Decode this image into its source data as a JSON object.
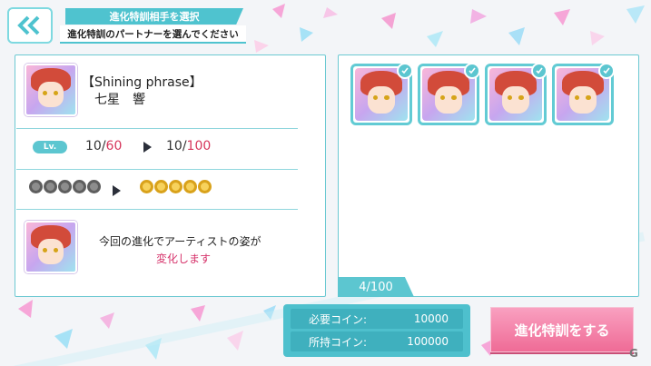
{
  "header": {
    "title": "進化特訓相手を選択",
    "subtitle": "進化特訓のパートナーを選んでください"
  },
  "card": {
    "phrase": "【Shining phrase】",
    "name": "七星　響",
    "lv_badge": "Lv.",
    "lv_current_before": "10/",
    "lv_max_before": "60",
    "lv_current_after": "10/",
    "lv_max_after": "100",
    "notes_before": 5,
    "notes_after": 5
  },
  "message": {
    "line1": "今回の進化でアーティストの姿が",
    "line2": "変化します"
  },
  "partners": {
    "selected_count": 4,
    "count_text": "4/100"
  },
  "coins": {
    "required_label": "必要コイン:",
    "required_value": "10000",
    "owned_label": "所持コイン:",
    "owned_value": "100000"
  },
  "evolve_button": "進化特訓をする",
  "watermark": "G",
  "colors": {
    "accent": "#4fc3cf",
    "pink": "#ef6b96",
    "highlight": "#d6365b"
  }
}
